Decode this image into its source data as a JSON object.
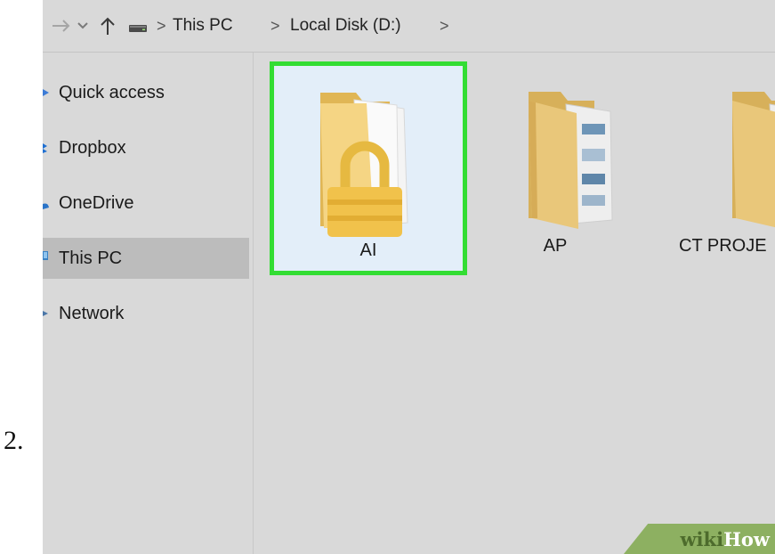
{
  "step_number": "2.",
  "address_bar": {
    "breadcrumbs": [
      "This PC",
      "Local Disk (D:)"
    ],
    "separator": ">",
    "forward_icon": "arrow-right-icon",
    "recent_icon": "chevron-down-icon",
    "up_icon": "arrow-up-icon",
    "drive_icon": "drive-icon"
  },
  "sidebar": {
    "items": [
      {
        "label": "Quick access",
        "icon": "star-icon",
        "icon_color": "#3c7bd6"
      },
      {
        "label": "Dropbox",
        "icon": "dropbox-icon",
        "icon_color": "#1f6fd1"
      },
      {
        "label": "OneDrive",
        "icon": "cloud-icon",
        "icon_color": "#2a74c8"
      },
      {
        "label": "This PC",
        "icon": "computer-icon",
        "icon_color": "#3b82c4",
        "selected": true
      },
      {
        "label": "Network",
        "icon": "network-icon",
        "icon_color": "#4a76a8"
      }
    ]
  },
  "folders": [
    {
      "name": "AI",
      "locked": true,
      "selected": true
    },
    {
      "name": "AP",
      "locked": false,
      "selected": false
    },
    {
      "name": "CT PROJE",
      "locked": false,
      "selected": false
    }
  ],
  "colors": {
    "window_background": "#d9d9d9",
    "selection_highlight": "#33dd33",
    "selected_tile": "#e3eef9",
    "folder_yellow": "#f0cc72"
  },
  "watermark": {
    "wiki": "wiki",
    "how": "How"
  }
}
